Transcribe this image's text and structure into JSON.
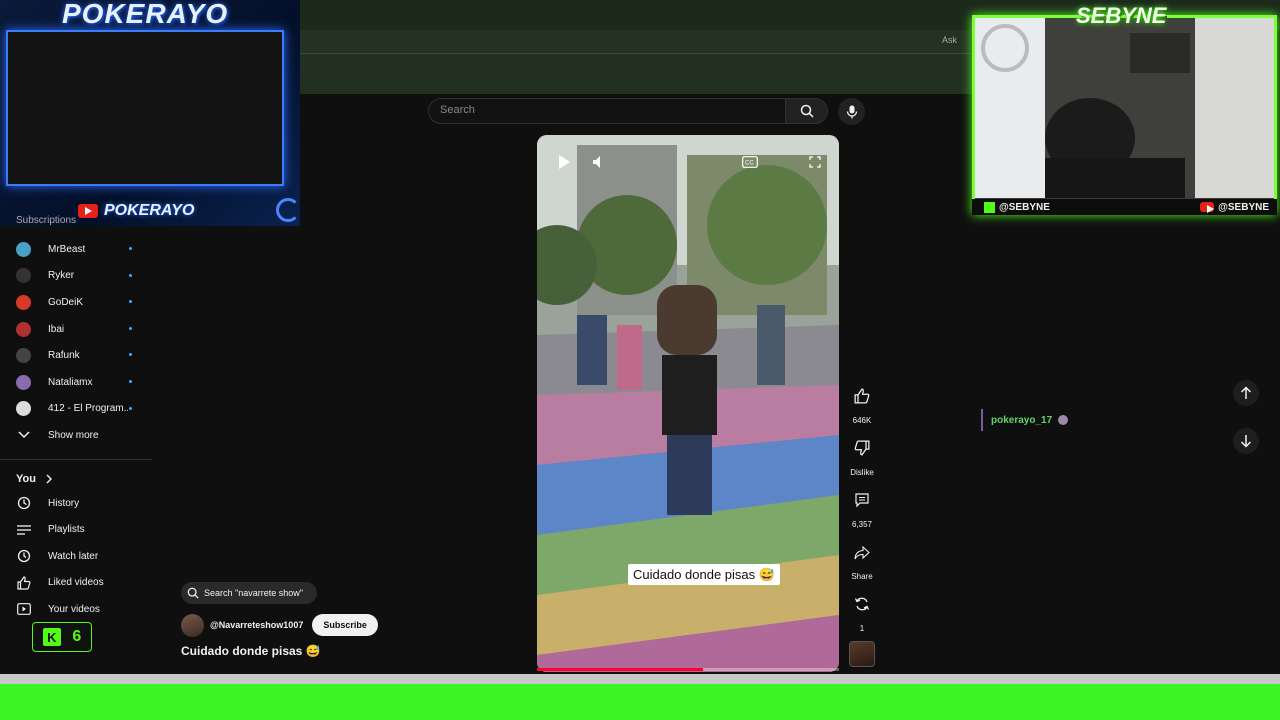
{
  "overlay_left": {
    "brand_top": "POKERAYO",
    "brand_bottom": "POKERAYO",
    "subscriptions_label": "Subscriptions"
  },
  "search": {
    "placeholder": "Search"
  },
  "sidebar": {
    "subscriptions": [
      {
        "label": "MrBeast",
        "color": "#4aa0c8"
      },
      {
        "label": "Ryker",
        "color": "#333333"
      },
      {
        "label": "GoDeiK",
        "color": "#d83a2a"
      },
      {
        "label": "Ibai",
        "color": "#b03030"
      },
      {
        "label": "Rafunk",
        "color": "#444444"
      },
      {
        "label": "Nataliamx",
        "color": "#8a6ab0"
      },
      {
        "label": "412 - El Program...",
        "color": "#dddddd"
      }
    ],
    "show_more": "Show more",
    "you_heading": "You",
    "you_items": [
      {
        "label": "History",
        "icon": "history-icon"
      },
      {
        "label": "Playlists",
        "icon": "playlists-icon"
      },
      {
        "label": "Watch later",
        "icon": "clock-icon"
      },
      {
        "label": "Liked videos",
        "icon": "thumbs-up-icon"
      },
      {
        "label": "Your videos",
        "icon": "video-icon"
      }
    ]
  },
  "video": {
    "caption": "Cuidado donde pisas 😅",
    "progress": 0.55,
    "search_chip": "Search \"navarrete show\"",
    "channel": "@Navarreteshow1007",
    "subscribe": "Subscribe",
    "title": "Cuidado donde pisas 😅"
  },
  "rail": {
    "likes": "646K",
    "dislike": "Dislike",
    "comments": "6,357",
    "share": "Share",
    "remix": "1"
  },
  "cam": {
    "brand": "SEBYNE",
    "kick_handle": "@SEBYNE",
    "yt_handle": "@SEBYNE",
    "ask": "Ask"
  },
  "chat": {
    "user": "pokerayo_17"
  },
  "kick_badge": {
    "count": "6"
  },
  "colors": {
    "accent_blue": "#3b7cff",
    "accent_green": "#53fc18",
    "yt_red": "#ff0033"
  }
}
